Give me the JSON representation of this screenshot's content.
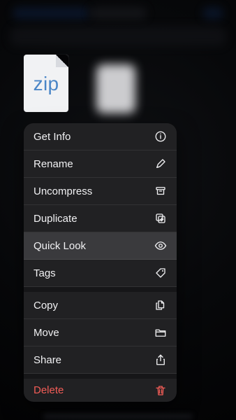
{
  "file": {
    "extension_label": "zip"
  },
  "menu": {
    "items": [
      {
        "label": "Get Info",
        "icon": "info-icon"
      },
      {
        "label": "Rename",
        "icon": "pencil-icon"
      },
      {
        "label": "Uncompress",
        "icon": "archive-icon"
      },
      {
        "label": "Duplicate",
        "icon": "duplicate-icon"
      },
      {
        "label": "Quick Look",
        "icon": "eye-icon",
        "highlighted": true
      },
      {
        "label": "Tags",
        "icon": "tag-icon"
      },
      {
        "label": "Copy",
        "icon": "copy-icon"
      },
      {
        "label": "Move",
        "icon": "folder-icon"
      },
      {
        "label": "Share",
        "icon": "share-icon"
      },
      {
        "label": "Delete",
        "icon": "trash-icon",
        "destructive": true
      }
    ]
  },
  "colors": {
    "menu_background": "#222224",
    "highlight": "#3a3a3d",
    "destructive": "#f35d57",
    "zip_text": "#4a86c7"
  }
}
